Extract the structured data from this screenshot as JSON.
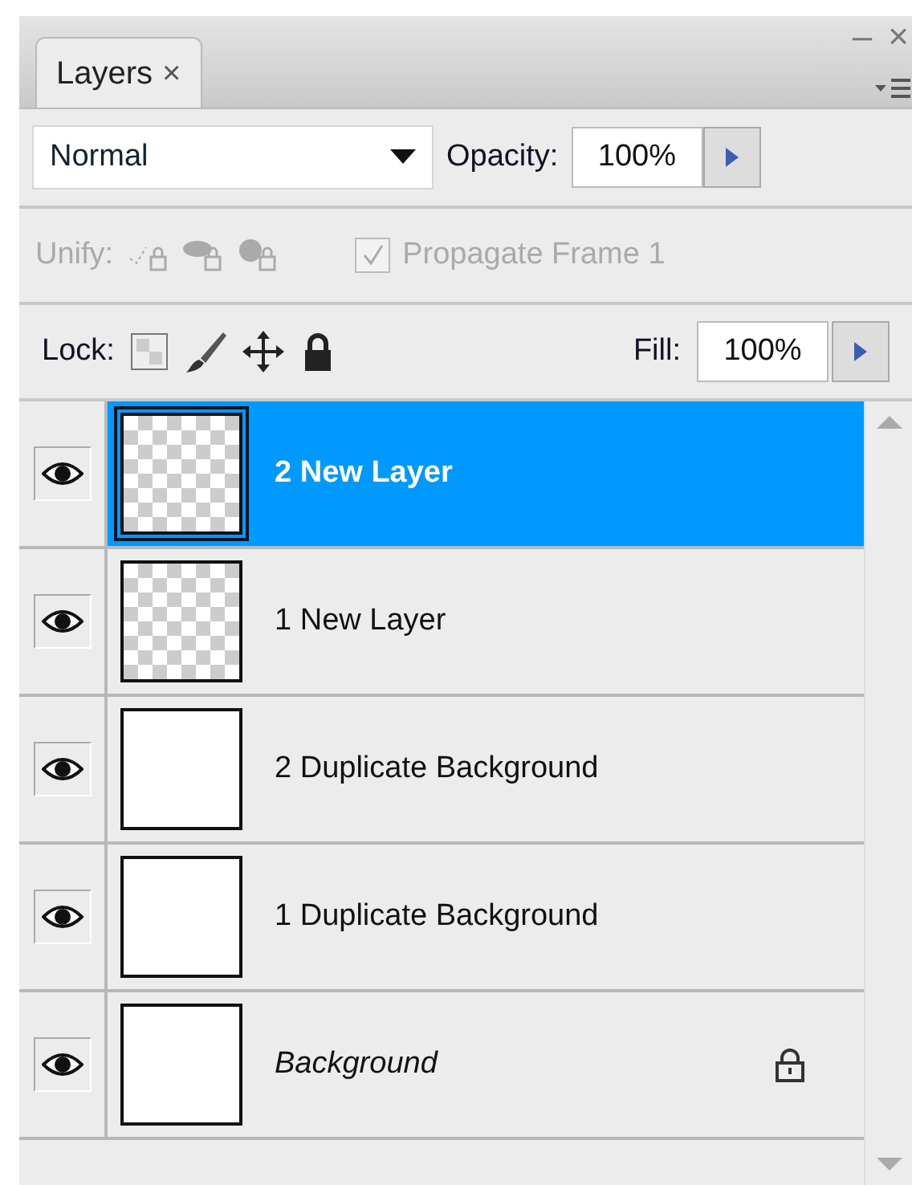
{
  "window_controls": {
    "minimize": "–",
    "close": "×"
  },
  "tab": {
    "label": "Layers",
    "close": "×",
    "selected": true
  },
  "blend_mode": "Normal",
  "opacity": {
    "label": "Opacity:",
    "value": "100%"
  },
  "unify": {
    "label": "Unify:",
    "disabled": true,
    "propagate": {
      "label": "Propagate Frame 1",
      "checked": true
    }
  },
  "lock": {
    "label": "Lock:"
  },
  "fill": {
    "label": "Fill:",
    "value": "100%"
  },
  "layers": [
    {
      "name": "2 New Layer",
      "kind": "layer",
      "transparent": true,
      "visible": true,
      "selected": true,
      "locked": false
    },
    {
      "name": "1 New Layer",
      "kind": "layer",
      "transparent": true,
      "visible": true,
      "selected": false,
      "locked": false
    },
    {
      "name": "2 Duplicate Background",
      "kind": "layer",
      "transparent": false,
      "visible": true,
      "selected": false,
      "locked": false
    },
    {
      "name": "1 Duplicate Background",
      "kind": "layer",
      "transparent": false,
      "visible": true,
      "selected": false,
      "locked": false
    },
    {
      "name": "Background",
      "kind": "background",
      "transparent": false,
      "visible": true,
      "selected": false,
      "locked": true
    }
  ]
}
